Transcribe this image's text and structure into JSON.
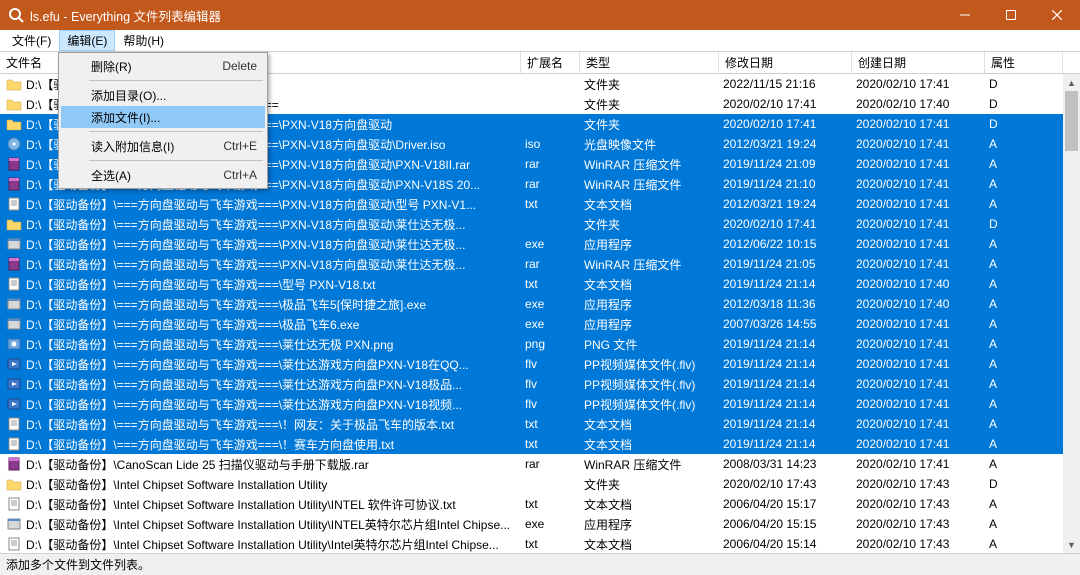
{
  "window": {
    "title": "ls.efu - Everything 文件列表编辑器"
  },
  "menubar": {
    "items": [
      {
        "label": "文件(F)"
      },
      {
        "label": "编辑(E)"
      },
      {
        "label": "帮助(H)"
      }
    ]
  },
  "dropdown": {
    "items": [
      {
        "label": "删除(R)",
        "shortcut": "Delete",
        "hl": false
      },
      {
        "sep": true
      },
      {
        "label": "添加目录(O)...",
        "shortcut": "",
        "hl": false
      },
      {
        "label": "添加文件(I)...",
        "shortcut": "",
        "hl": true
      },
      {
        "sep": true
      },
      {
        "label": "读入附加信息(I)",
        "shortcut": "Ctrl+E",
        "hl": false
      },
      {
        "sep": true
      },
      {
        "label": "全选(A)",
        "shortcut": "Ctrl+A",
        "hl": false
      }
    ]
  },
  "columns": [
    {
      "key": "name",
      "label": "文件名",
      "w": "w-name"
    },
    {
      "key": "ext",
      "label": "扩展名",
      "w": "w-ext"
    },
    {
      "key": "type",
      "label": "类型",
      "w": "w-type"
    },
    {
      "key": "mod",
      "label": "修改日期",
      "w": "w-mod"
    },
    {
      "key": "cre",
      "label": "创建日期",
      "w": "w-cre"
    },
    {
      "key": "attr",
      "label": "属性",
      "w": "w-attr"
    }
  ],
  "rows": [
    {
      "sel": false,
      "icon": "folder",
      "name": "D:\\【驱动备份】",
      "ext": "",
      "type": "文件夹",
      "mod": "2022/11/15 21:16",
      "cre": "2020/02/10 17:41",
      "attr": "D"
    },
    {
      "sel": false,
      "icon": "folder",
      "name": "D:\\【驱动备份】\\===方向盘驱动与飞车游戏===",
      "ext": "",
      "type": "文件夹",
      "mod": "2020/02/10 17:41",
      "cre": "2020/02/10 17:40",
      "attr": "D"
    },
    {
      "sel": true,
      "icon": "folder",
      "name": "D:\\【驱动备份】\\===方向盘驱动与飞车游戏===\\PXN-V18方向盘驱动",
      "ext": "",
      "type": "文件夹",
      "mod": "2020/02/10 17:41",
      "cre": "2020/02/10 17:41",
      "attr": "D"
    },
    {
      "sel": true,
      "icon": "iso",
      "name": "D:\\【驱动备份】\\===方向盘驱动与飞车游戏===\\PXN-V18方向盘驱动\\Driver.iso",
      "ext": "iso",
      "type": "光盘映像文件",
      "mod": "2012/03/21 19:24",
      "cre": "2020/02/10 17:41",
      "attr": "A"
    },
    {
      "sel": true,
      "icon": "rar",
      "name": "D:\\【驱动备份】\\===方向盘驱动与飞车游戏===\\PXN-V18方向盘驱动\\PXN-V18II.rar",
      "ext": "rar",
      "type": "WinRAR 压缩文件",
      "mod": "2019/11/24 21:09",
      "cre": "2020/02/10 17:41",
      "attr": "A"
    },
    {
      "sel": true,
      "icon": "rar",
      "name": "D:\\【驱动备份】\\===方向盘驱动与飞车游戏===\\PXN-V18方向盘驱动\\PXN-V18S 20...",
      "ext": "rar",
      "type": "WinRAR 压缩文件",
      "mod": "2019/11/24 21:10",
      "cre": "2020/02/10 17:41",
      "attr": "A"
    },
    {
      "sel": true,
      "icon": "txt",
      "name": "D:\\【驱动备份】\\===方向盘驱动与飞车游戏===\\PXN-V18方向盘驱动\\型号 PXN-V1...",
      "ext": "txt",
      "type": "文本文档",
      "mod": "2012/03/21 19:24",
      "cre": "2020/02/10 17:41",
      "attr": "A"
    },
    {
      "sel": true,
      "icon": "folder",
      "name": "D:\\【驱动备份】\\===方向盘驱动与飞车游戏===\\PXN-V18方向盘驱动\\莱仕达无极...",
      "ext": "",
      "type": "文件夹",
      "mod": "2020/02/10 17:41",
      "cre": "2020/02/10 17:41",
      "attr": "D"
    },
    {
      "sel": true,
      "icon": "exe",
      "name": "D:\\【驱动备份】\\===方向盘驱动与飞车游戏===\\PXN-V18方向盘驱动\\莱仕达无极...",
      "ext": "exe",
      "type": "应用程序",
      "mod": "2012/06/22 10:15",
      "cre": "2020/02/10 17:41",
      "attr": "A"
    },
    {
      "sel": true,
      "icon": "rar",
      "name": "D:\\【驱动备份】\\===方向盘驱动与飞车游戏===\\PXN-V18方向盘驱动\\莱仕达无极...",
      "ext": "rar",
      "type": "WinRAR 压缩文件",
      "mod": "2019/11/24 21:05",
      "cre": "2020/02/10 17:41",
      "attr": "A"
    },
    {
      "sel": true,
      "icon": "txt",
      "name": "D:\\【驱动备份】\\===方向盘驱动与飞车游戏===\\型号 PXN-V18.txt",
      "ext": "txt",
      "type": "文本文档",
      "mod": "2019/11/24 21:14",
      "cre": "2020/02/10 17:40",
      "attr": "A"
    },
    {
      "sel": true,
      "icon": "exe",
      "name": "D:\\【驱动备份】\\===方向盘驱动与飞车游戏===\\极品飞车5[保时捷之旅].exe",
      "ext": "exe",
      "type": "应用程序",
      "mod": "2012/03/18 11:36",
      "cre": "2020/02/10 17:40",
      "attr": "A"
    },
    {
      "sel": true,
      "icon": "exe",
      "name": "D:\\【驱动备份】\\===方向盘驱动与飞车游戏===\\极品飞车6.exe",
      "ext": "exe",
      "type": "应用程序",
      "mod": "2007/03/26 14:55",
      "cre": "2020/02/10 17:41",
      "attr": "A"
    },
    {
      "sel": true,
      "icon": "png",
      "name": "D:\\【驱动备份】\\===方向盘驱动与飞车游戏===\\莱仕达无极 PXN.png",
      "ext": "png",
      "type": "PNG 文件",
      "mod": "2019/11/24 21:14",
      "cre": "2020/02/10 17:41",
      "attr": "A"
    },
    {
      "sel": true,
      "icon": "flv",
      "name": "D:\\【驱动备份】\\===方向盘驱动与飞车游戏===\\莱仕达游戏方向盘PXN-V18在QQ...",
      "ext": "flv",
      "type": "PP视频媒体文件(.flv)",
      "mod": "2019/11/24 21:14",
      "cre": "2020/02/10 17:41",
      "attr": "A"
    },
    {
      "sel": true,
      "icon": "flv",
      "name": "D:\\【驱动备份】\\===方向盘驱动与飞车游戏===\\莱仕达游戏方向盘PXN-V18极品...",
      "ext": "flv",
      "type": "PP视频媒体文件(.flv)",
      "mod": "2019/11/24 21:14",
      "cre": "2020/02/10 17:41",
      "attr": "A"
    },
    {
      "sel": true,
      "icon": "flv",
      "name": "D:\\【驱动备份】\\===方向盘驱动与飞车游戏===\\莱仕达游戏方向盘PXN-V18视频...",
      "ext": "flv",
      "type": "PP视频媒体文件(.flv)",
      "mod": "2019/11/24 21:14",
      "cre": "2020/02/10 17:41",
      "attr": "A"
    },
    {
      "sel": true,
      "icon": "txt",
      "name": "D:\\【驱动备份】\\===方向盘驱动与飞车游戏===\\！网友：关于极品飞车的版本.txt",
      "ext": "txt",
      "type": "文本文档",
      "mod": "2019/11/24 21:14",
      "cre": "2020/02/10 17:41",
      "attr": "A"
    },
    {
      "sel": true,
      "icon": "txt",
      "name": "D:\\【驱动备份】\\===方向盘驱动与飞车游戏===\\！赛车方向盘使用.txt",
      "ext": "txt",
      "type": "文本文档",
      "mod": "2019/11/24 21:14",
      "cre": "2020/02/10 17:41",
      "attr": "A"
    },
    {
      "sel": false,
      "icon": "rar",
      "name": "D:\\【驱动备份】\\CanoScan Lide 25 扫描仪驱动与手册下载版.rar",
      "ext": "rar",
      "type": "WinRAR 压缩文件",
      "mod": "2008/03/31 14:23",
      "cre": "2020/02/10 17:41",
      "attr": "A"
    },
    {
      "sel": false,
      "icon": "folder",
      "name": "D:\\【驱动备份】\\Intel Chipset Software Installation Utility",
      "ext": "",
      "type": "文件夹",
      "mod": "2020/02/10 17:43",
      "cre": "2020/02/10 17:43",
      "attr": "D"
    },
    {
      "sel": false,
      "icon": "txt",
      "name": "D:\\【驱动备份】\\Intel Chipset Software Installation Utility\\INTEL 软件许可协议.txt",
      "ext": "txt",
      "type": "文本文档",
      "mod": "2006/04/20 15:17",
      "cre": "2020/02/10 17:43",
      "attr": "A"
    },
    {
      "sel": false,
      "icon": "exe",
      "name": "D:\\【驱动备份】\\Intel Chipset Software Installation Utility\\INTEL英特尔芯片组Intel Chipse...",
      "ext": "exe",
      "type": "应用程序",
      "mod": "2006/04/20 15:15",
      "cre": "2020/02/10 17:43",
      "attr": "A"
    },
    {
      "sel": false,
      "icon": "txt",
      "name": "D:\\【驱动备份】\\Intel Chipset Software Installation Utility\\Intel英特尔芯片组Intel Chipse...",
      "ext": "txt",
      "type": "文本文档",
      "mod": "2006/04/20 15:14",
      "cre": "2020/02/10 17:43",
      "attr": "A"
    }
  ],
  "status": {
    "text": "添加多个文件到文件列表。"
  },
  "icons": {
    "folder": {
      "fill": "#ffd86b",
      "stroke": "#c7a040"
    },
    "iso": {
      "fill": "#7fb6e8",
      "stroke": "#4a7db0"
    },
    "rar": {
      "fill": "#8b3a8b",
      "stroke": "#5a1a5a"
    },
    "txt": {
      "fill": "#ffffff",
      "stroke": "#888",
      "lines": true
    },
    "exe": {
      "fill": "#d7d7d7",
      "stroke": "#888",
      "box": true
    },
    "png": {
      "fill": "#6aa8e0",
      "stroke": "#3a70b0",
      "circ": true
    },
    "flv": {
      "fill": "#3a77c8",
      "stroke": "#1a4a90",
      "play": true
    }
  }
}
